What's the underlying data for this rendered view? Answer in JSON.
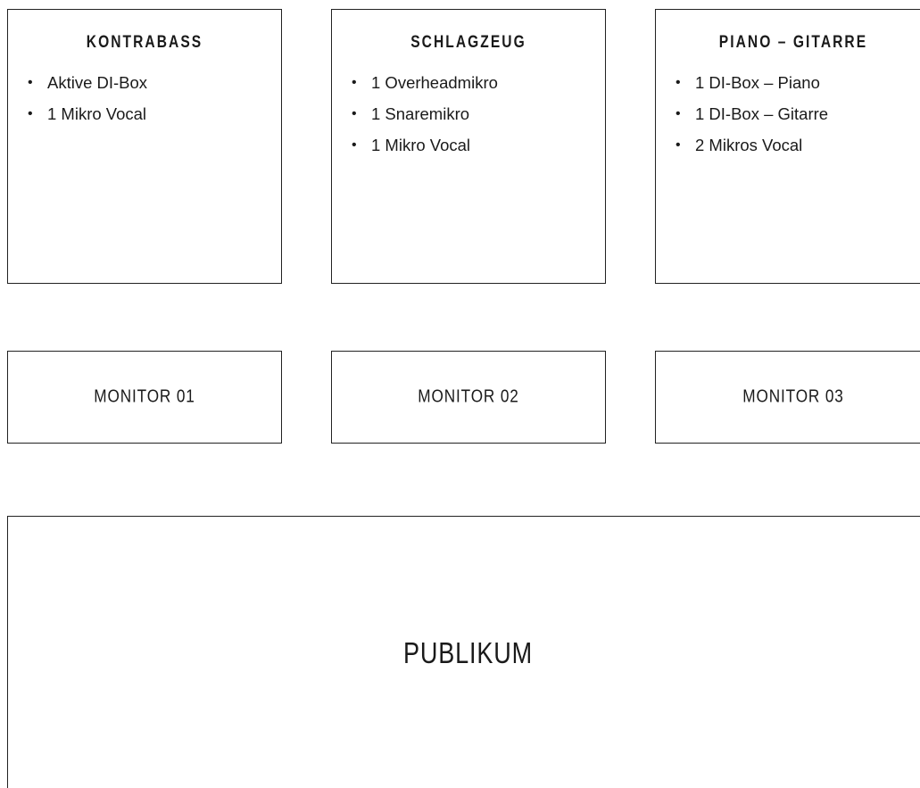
{
  "stations": [
    {
      "title": "KONTRABASS",
      "items": [
        "Aktive DI-Box",
        "1 Mikro Vocal"
      ]
    },
    {
      "title": "SCHLAGZEUG",
      "items": [
        "1 Overheadmikro",
        "1 Snaremikro",
        "1 Mikro Vocal"
      ]
    },
    {
      "title": "PIANO – GITARRE",
      "items": [
        "1 DI-Box – Piano",
        "1 DI-Box – Gitarre",
        "2 Mikros Vocal"
      ]
    }
  ],
  "monitors": [
    "MONITOR 01",
    "MONITOR 02",
    "MONITOR 03"
  ],
  "audience": {
    "label": "PUBLIKUM"
  },
  "colors": {
    "border": "#222222",
    "text": "#1a1a1a",
    "background": "#ffffff"
  }
}
